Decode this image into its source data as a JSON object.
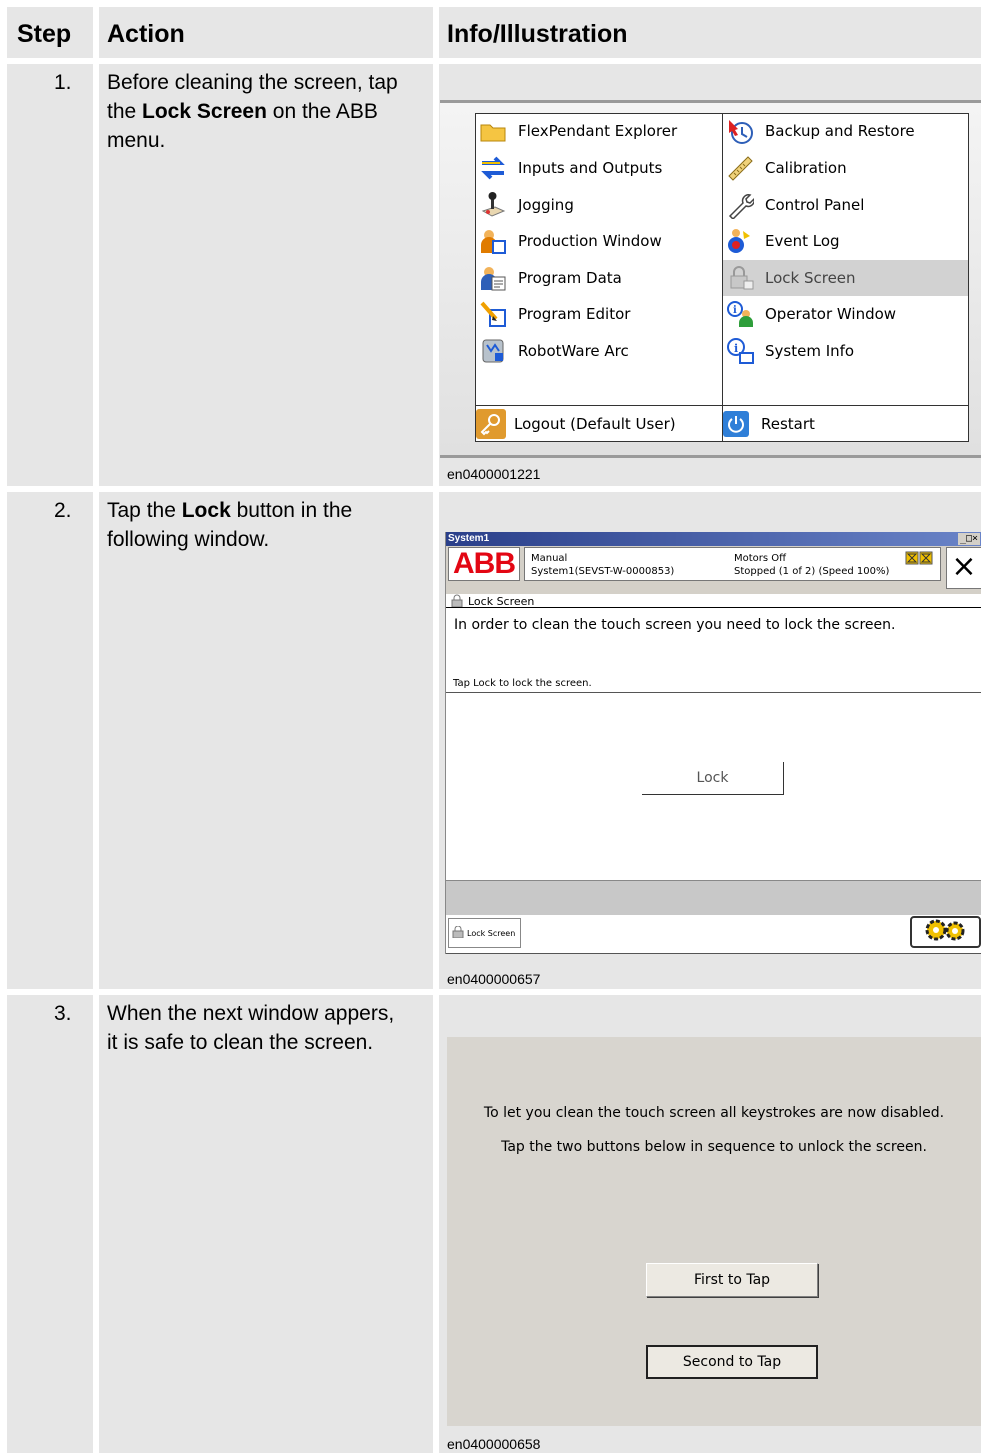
{
  "table": {
    "headers": [
      "Step",
      "Action",
      "Info/Illustration"
    ],
    "rows": [
      {
        "step": "1.",
        "action_pre": "Before cleaning the screen, tap",
        "action_pre2": "the ",
        "action_bold": "Lock Screen",
        "action_post": " on the ABB",
        "action_post2": "menu.",
        "figure_id": "en0400001221"
      },
      {
        "step": "2.",
        "action_pre": "Tap the ",
        "action_bold": "Lock",
        "action_post": " button in the",
        "action_post2": "following window.",
        "figure_id": "en0400000657"
      },
      {
        "step": "3.",
        "action_line1": "When the next window appers,",
        "action_line2": "it is safe to clean the screen.",
        "figure_id": "en0400000658"
      }
    ]
  },
  "abb_menu": {
    "left_items": [
      {
        "label": "FlexPendant Explorer",
        "icon": "folder-icon"
      },
      {
        "label": "Inputs and Outputs",
        "icon": "io-arrows-icon"
      },
      {
        "label": "Jogging",
        "icon": "joystick-icon"
      },
      {
        "label": "Production Window",
        "icon": "production-window-icon"
      },
      {
        "label": "Program Data",
        "icon": "program-data-icon"
      },
      {
        "label": "Program Editor",
        "icon": "program-editor-icon"
      },
      {
        "label": "RobotWare Arc",
        "icon": "robotware-arc-icon"
      }
    ],
    "right_items": [
      {
        "label": "Backup and Restore",
        "icon": "backup-restore-icon"
      },
      {
        "label": "Calibration",
        "icon": "calibration-ruler-icon"
      },
      {
        "label": "Control Panel",
        "icon": "wrench-icon"
      },
      {
        "label": "Event Log",
        "icon": "event-log-icon"
      },
      {
        "label": "Lock Screen",
        "icon": "lock-icon",
        "selected": true
      },
      {
        "label": "Operator Window",
        "icon": "operator-window-icon"
      },
      {
        "label": "System Info",
        "icon": "system-info-icon"
      }
    ],
    "logout_label": "Logout (Default User)",
    "restart_label": "Restart"
  },
  "flexpendant": {
    "window_title": "System1",
    "window_buttons": "_□×",
    "logo": "ABB",
    "mode": "Manual",
    "system": "System1(SEVST-W-0000853)",
    "motors": "Motors Off",
    "state": "Stopped (1 of 2) (Speed 100%)",
    "close_glyph": "×",
    "breadcrumb": "Lock Screen",
    "intro": "In order to clean the touch screen you need to lock the screen.",
    "instruction": "Tap Lock to lock the screen.",
    "lock_button": "Lock",
    "taskbar_item": "Lock Screen"
  },
  "locked_screen": {
    "message1": "To let you clean the touch screen all keystrokes are now disabled.",
    "message2": "Tap the two buttons below in sequence to unlock the screen.",
    "first_button": "First to Tap",
    "second_button": "Second to Tap"
  }
}
